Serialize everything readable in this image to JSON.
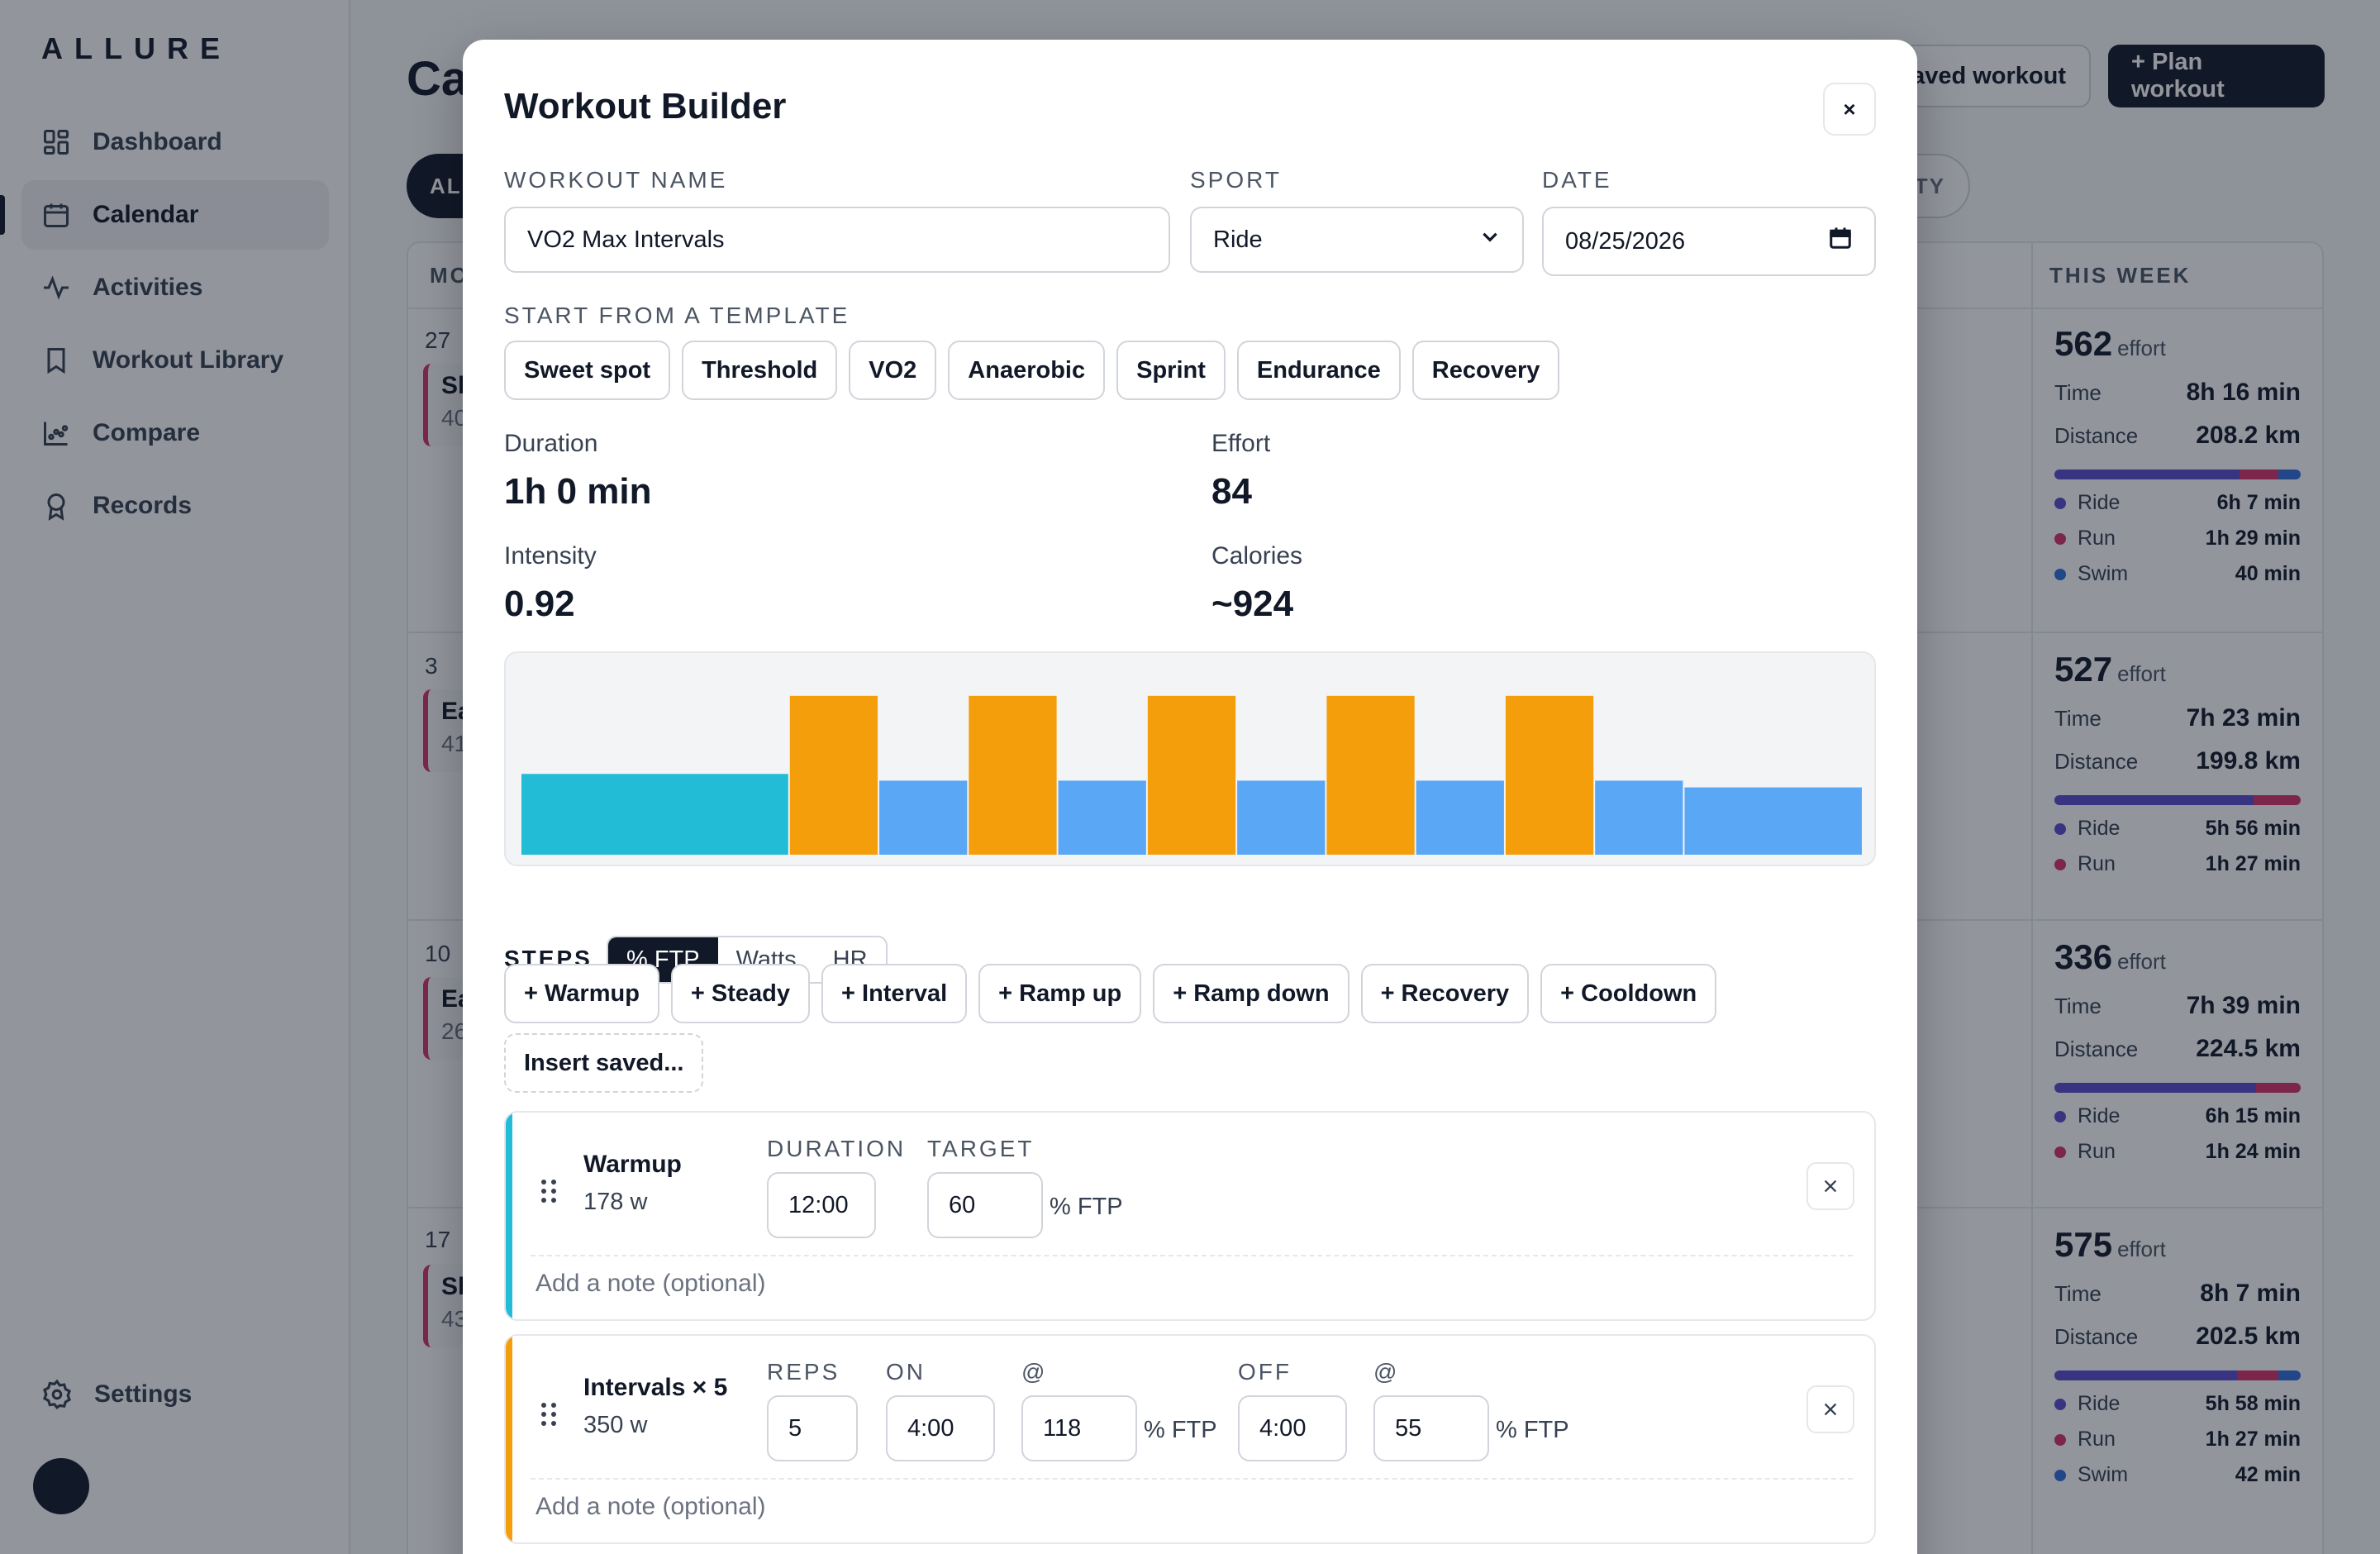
{
  "brand": "ALLURE",
  "nav": [
    {
      "label": "Dashboard",
      "icon": "dashboard-icon",
      "active": false
    },
    {
      "label": "Calendar",
      "icon": "calendar-icon",
      "active": true
    },
    {
      "label": "Activities",
      "icon": "activity-icon",
      "active": false
    },
    {
      "label": "Workout Library",
      "icon": "bookmark-icon",
      "active": false
    },
    {
      "label": "Compare",
      "icon": "chart-icon",
      "active": false
    },
    {
      "label": "Records",
      "icon": "award-icon",
      "active": false
    }
  ],
  "settings_label": "Settings",
  "background": {
    "title_fragment": "Ca",
    "saved_workout_btn": "aved workout",
    "plan_workout_btn": "+ Plan workout",
    "filter_all": "AL",
    "filter_right": "TY",
    "cal_head": "MO",
    "this_week": "THIS WEEK",
    "days": [
      {
        "num": "27",
        "event_title": "Sh",
        "event_sub": "40"
      },
      {
        "num": "3",
        "event_title": "Ea",
        "event_sub": "41"
      },
      {
        "num": "10",
        "event_title": "Ea",
        "event_sub": "26"
      },
      {
        "num": "17",
        "event_title": "Sh",
        "event_sub": "43"
      }
    ],
    "weeks": [
      {
        "effort": "562",
        "effort_unit": "effort",
        "time_label": "Time",
        "time": "8h 16 min",
        "distance_label": "Distance",
        "distance": "208.2 km",
        "split": [
          0.75,
          0.16,
          0.09
        ],
        "sports": [
          {
            "name": "Ride",
            "value": "6h 7 min",
            "color": "#5b4ccf"
          },
          {
            "name": "Run",
            "value": "1h 29 min",
            "color": "#d6336c"
          },
          {
            "name": "Swim",
            "value": "40 min",
            "color": "#2f6fdd"
          }
        ]
      },
      {
        "effort": "527",
        "effort_unit": "effort",
        "time_label": "Time",
        "time": "7h 23 min",
        "distance_label": "Distance",
        "distance": "199.8 km",
        "split": [
          0.81,
          0.19,
          0
        ],
        "sports": [
          {
            "name": "Ride",
            "value": "5h 56 min",
            "color": "#5b4ccf"
          },
          {
            "name": "Run",
            "value": "1h 27 min",
            "color": "#d6336c"
          }
        ]
      },
      {
        "effort": "336",
        "effort_unit": "effort",
        "time_label": "Time",
        "time": "7h 39 min",
        "distance_label": "Distance",
        "distance": "224.5 km",
        "split": [
          0.82,
          0.18,
          0
        ],
        "sports": [
          {
            "name": "Ride",
            "value": "6h 15 min",
            "color": "#5b4ccf"
          },
          {
            "name": "Run",
            "value": "1h 24 min",
            "color": "#d6336c"
          }
        ]
      },
      {
        "effort": "575",
        "effort_unit": "effort",
        "time_label": "Time",
        "time": "8h 7 min",
        "distance_label": "Distance",
        "distance": "202.5 km",
        "split": [
          0.74,
          0.17,
          0.09
        ],
        "sports": [
          {
            "name": "Ride",
            "value": "5h 58 min",
            "color": "#5b4ccf"
          },
          {
            "name": "Run",
            "value": "1h 27 min",
            "color": "#d6336c"
          },
          {
            "name": "Swim",
            "value": "42 min",
            "color": "#2f6fdd"
          }
        ]
      }
    ]
  },
  "modal": {
    "title": "Workout Builder",
    "close": "×",
    "name_label": "WORKOUT NAME",
    "name_value": "VO2 Max Intervals",
    "sport_label": "SPORT",
    "sport_value": "Ride",
    "date_label": "DATE",
    "date_value": "08/25/2026",
    "template_label": "START FROM A TEMPLATE",
    "templates": [
      "Sweet spot",
      "Threshold",
      "VO2",
      "Anaerobic",
      "Sprint",
      "Endurance",
      "Recovery"
    ],
    "stats": {
      "duration_label": "Duration",
      "duration": "1h 0 min",
      "effort_label": "Effort",
      "effort": "84",
      "intensity_label": "Intensity",
      "intensity": "0.92",
      "calories_label": "Calories",
      "calories": "~924"
    },
    "steps_label": "STEPS",
    "units": [
      "% FTP",
      "Watts",
      "HR"
    ],
    "active_unit": "% FTP",
    "add_buttons": [
      "+ Warmup",
      "+ Steady",
      "+ Interval",
      "+ Ramp up",
      "+ Ramp down",
      "+ Recovery",
      "+ Cooldown"
    ],
    "insert_saved": "Insert saved...",
    "steps": [
      {
        "name": "Warmup",
        "watts": "178 w",
        "duration_label": "DURATION",
        "duration": "12:00",
        "target_label": "TARGET",
        "target": "60",
        "unit": "% FTP",
        "note_placeholder": "Add a note (optional)",
        "color": "#22bcd6"
      },
      {
        "name": "Intervals × 5",
        "watts": "350 w",
        "reps_label": "REPS",
        "reps": "5",
        "on_label": "ON",
        "on": "4:00",
        "at_label": "@",
        "on_target": "118",
        "unit": "% FTP",
        "off_label": "OFF",
        "off": "4:00",
        "off_target": "55",
        "note_placeholder": "Add a note (optional)",
        "color": "#f59e0b"
      }
    ]
  },
  "chart_data": {
    "type": "bar",
    "title": "",
    "xlabel": "",
    "ylabel": "",
    "ylim": [
      0,
      140
    ],
    "segments": [
      {
        "label": "Warmup",
        "duration_min": 12,
        "ftp_pct": 60,
        "color": "#22bcd6"
      },
      {
        "label": "On",
        "duration_min": 4,
        "ftp_pct": 118,
        "color": "#f59e0b"
      },
      {
        "label": "Off",
        "duration_min": 4,
        "ftp_pct": 55,
        "color": "#5aa7f5"
      },
      {
        "label": "On",
        "duration_min": 4,
        "ftp_pct": 118,
        "color": "#f59e0b"
      },
      {
        "label": "Off",
        "duration_min": 4,
        "ftp_pct": 55,
        "color": "#5aa7f5"
      },
      {
        "label": "On",
        "duration_min": 4,
        "ftp_pct": 118,
        "color": "#f59e0b"
      },
      {
        "label": "Off",
        "duration_min": 4,
        "ftp_pct": 55,
        "color": "#5aa7f5"
      },
      {
        "label": "On",
        "duration_min": 4,
        "ftp_pct": 118,
        "color": "#f59e0b"
      },
      {
        "label": "Off",
        "duration_min": 4,
        "ftp_pct": 55,
        "color": "#5aa7f5"
      },
      {
        "label": "On",
        "duration_min": 4,
        "ftp_pct": 118,
        "color": "#f59e0b"
      },
      {
        "label": "Off",
        "duration_min": 4,
        "ftp_pct": 55,
        "color": "#5aa7f5"
      },
      {
        "label": "Cooldown",
        "duration_min": 8,
        "ftp_pct": 50,
        "color": "#5aa7f5"
      }
    ]
  }
}
